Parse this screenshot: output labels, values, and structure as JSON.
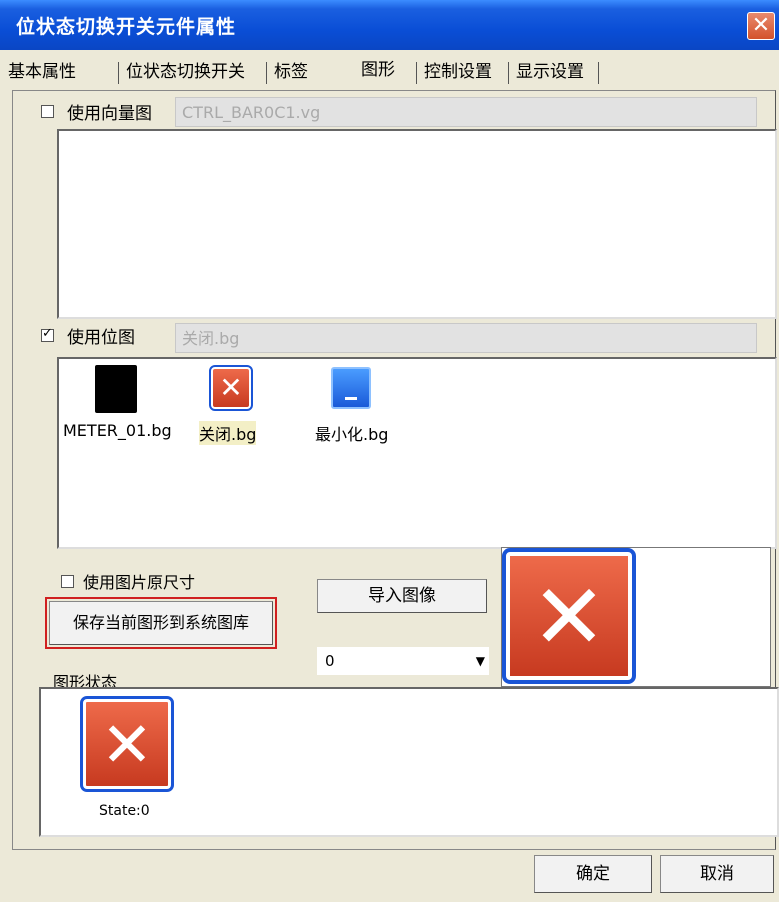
{
  "window": {
    "title": "位状态切换开关元件属性",
    "close_icon": "close-icon"
  },
  "tabs": [
    "基本属性",
    "位状态切换开关",
    "标签",
    "图形",
    "控制设置",
    "显示设置"
  ],
  "vector": {
    "label": "使用向量图",
    "checked": false,
    "filename": "CTRL_BAR0C1.vg"
  },
  "bitmap": {
    "label": "使用位图",
    "checked": true,
    "filename": "关闭.bg",
    "items": [
      {
        "name": "METER_01.bg",
        "icon": "meter-icon"
      },
      {
        "name": "关闭.bg",
        "icon": "close-icon",
        "selected": true
      },
      {
        "name": "最小化.bg",
        "icon": "minimize-icon"
      }
    ]
  },
  "original_size": {
    "label": "使用图片原尺寸",
    "checked": false
  },
  "save_button": "保存当前图形到系统图库",
  "import_button": "导入图像",
  "state_select": {
    "value": "0"
  },
  "state_section": {
    "label": "图形状态",
    "states": [
      {
        "name": "State:0"
      }
    ]
  },
  "footer": {
    "ok": "确定",
    "cancel": "取消"
  },
  "colors": {
    "title_bar": "#0a4ed6",
    "highlight_border": "#d02020",
    "icon_red": "#d64a2c",
    "icon_blue": "#1a5ad8"
  }
}
